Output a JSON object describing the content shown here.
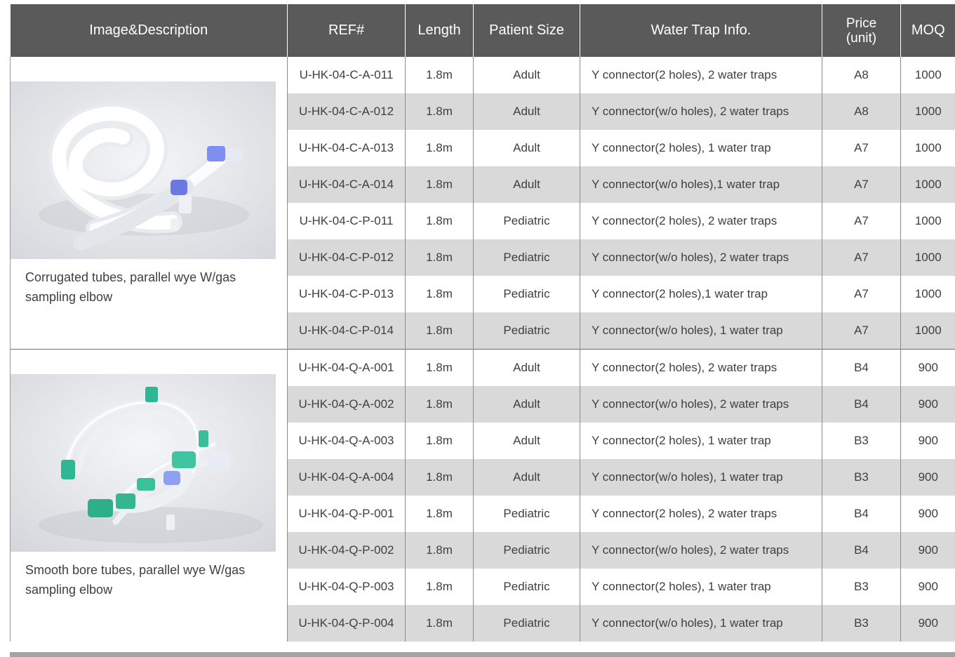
{
  "columns": {
    "image_desc": "Image&Description",
    "ref": "REF#",
    "length": "Length",
    "patient_size": "Patient Size",
    "water_trap": "Water Trap Info.",
    "price_line1": "Price",
    "price_line2": "(unit)",
    "moq": "MOQ"
  },
  "groups": [
    {
      "description": "Corrugated tubes, parallel wye W/gas sampling elbow",
      "image": "corrugated-tube-photo",
      "rows": [
        {
          "ref": "U-HK-04-C-A-011",
          "length": "1.8m",
          "size": "Adult",
          "trap": "Y connector(2 holes), 2 water traps",
          "price": "A8",
          "moq": "1000"
        },
        {
          "ref": "U-HK-04-C-A-012",
          "length": "1.8m",
          "size": "Adult",
          "trap": "Y connector(w/o holes), 2 water traps",
          "price": "A8",
          "moq": "1000"
        },
        {
          "ref": "U-HK-04-C-A-013",
          "length": "1.8m",
          "size": "Adult",
          "trap": "Y connector(2 holes), 1 water trap",
          "price": "A7",
          "moq": "1000"
        },
        {
          "ref": "U-HK-04-C-A-014",
          "length": "1.8m",
          "size": "Adult",
          "trap": "Y connector(w/o holes),1 water trap",
          "price": "A7",
          "moq": "1000"
        },
        {
          "ref": "U-HK-04-C-P-011",
          "length": "1.8m",
          "size": "Pediatric",
          "trap": "Y connector(2 holes), 2 water traps",
          "price": "A7",
          "moq": "1000"
        },
        {
          "ref": "U-HK-04-C-P-012",
          "length": "1.8m",
          "size": "Pediatric",
          "trap": "Y connector(w/o holes), 2 water traps",
          "price": "A7",
          "moq": "1000"
        },
        {
          "ref": "U-HK-04-C-P-013",
          "length": "1.8m",
          "size": "Pediatric",
          "trap": "Y connector(2 holes),1 water trap",
          "price": "A7",
          "moq": "1000"
        },
        {
          "ref": "U-HK-04-C-P-014",
          "length": "1.8m",
          "size": "Pediatric",
          "trap": "Y connector(w/o holes), 1 water trap",
          "price": "A7",
          "moq": "1000"
        }
      ]
    },
    {
      "description": "Smooth bore tubes, parallel wye W/gas sampling elbow",
      "image": "smooth-bore-tube-photo",
      "rows": [
        {
          "ref": "U-HK-04-Q-A-001",
          "length": "1.8m",
          "size": "Adult",
          "trap": "Y connector(2 holes), 2 water traps",
          "price": "B4",
          "moq": "900"
        },
        {
          "ref": "U-HK-04-Q-A-002",
          "length": "1.8m",
          "size": "Adult",
          "trap": " Y connector(w/o holes), 2 water traps",
          "price": "B4",
          "moq": "900"
        },
        {
          "ref": "U-HK-04-Q-A-003",
          "length": "1.8m",
          "size": "Adult",
          "trap": "Y connector(2 holes), 1 water trap",
          "price": "B3",
          "moq": "900"
        },
        {
          "ref": "U-HK-04-Q-A-004",
          "length": "1.8m",
          "size": "Adult",
          "trap": "Y connector(w/o holes), 1 water trap",
          "price": "B3",
          "moq": "900"
        },
        {
          "ref": "U-HK-04-Q-P-001",
          "length": "1.8m",
          "size": "Pediatric",
          "trap": "Y connector(2 holes), 2 water traps",
          "price": "B4",
          "moq": "900"
        },
        {
          "ref": "U-HK-04-Q-P-002",
          "length": "1.8m",
          "size": "Pediatric",
          "trap": "Y connector(w/o holes), 2 water traps",
          "price": "B4",
          "moq": "900"
        },
        {
          "ref": "U-HK-04-Q-P-003",
          "length": "1.8m",
          "size": "Pediatric",
          "trap": "Y connector(2 holes), 1 water trap",
          "price": "B3",
          "moq": "900"
        },
        {
          "ref": "U-HK-04-Q-P-004",
          "length": "1.8m",
          "size": "Pediatric",
          "trap": "Y connector(w/o holes), 1 water trap",
          "price": "B3",
          "moq": "900"
        }
      ]
    }
  ]
}
